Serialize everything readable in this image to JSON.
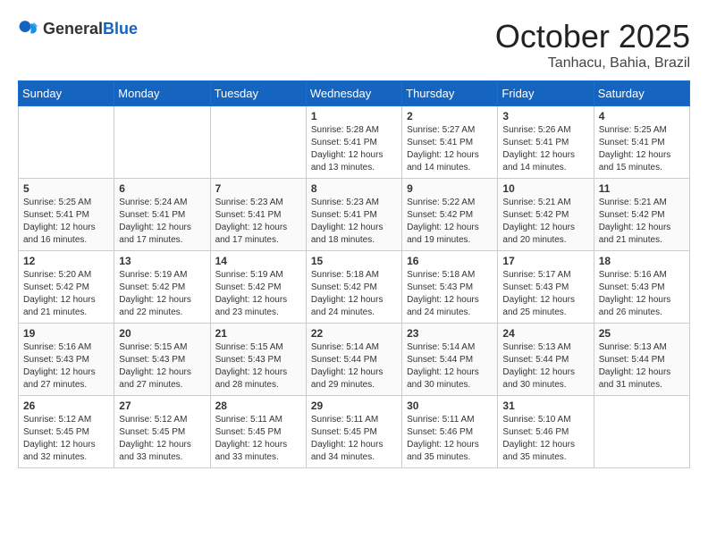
{
  "header": {
    "logo_general": "General",
    "logo_blue": "Blue",
    "month": "October 2025",
    "location": "Tanhacu, Bahia, Brazil"
  },
  "days_of_week": [
    "Sunday",
    "Monday",
    "Tuesday",
    "Wednesday",
    "Thursday",
    "Friday",
    "Saturday"
  ],
  "weeks": [
    [
      {
        "day": "",
        "info": ""
      },
      {
        "day": "",
        "info": ""
      },
      {
        "day": "",
        "info": ""
      },
      {
        "day": "1",
        "info": "Sunrise: 5:28 AM\nSunset: 5:41 PM\nDaylight: 12 hours\nand 13 minutes."
      },
      {
        "day": "2",
        "info": "Sunrise: 5:27 AM\nSunset: 5:41 PM\nDaylight: 12 hours\nand 14 minutes."
      },
      {
        "day": "3",
        "info": "Sunrise: 5:26 AM\nSunset: 5:41 PM\nDaylight: 12 hours\nand 14 minutes."
      },
      {
        "day": "4",
        "info": "Sunrise: 5:25 AM\nSunset: 5:41 PM\nDaylight: 12 hours\nand 15 minutes."
      }
    ],
    [
      {
        "day": "5",
        "info": "Sunrise: 5:25 AM\nSunset: 5:41 PM\nDaylight: 12 hours\nand 16 minutes."
      },
      {
        "day": "6",
        "info": "Sunrise: 5:24 AM\nSunset: 5:41 PM\nDaylight: 12 hours\nand 17 minutes."
      },
      {
        "day": "7",
        "info": "Sunrise: 5:23 AM\nSunset: 5:41 PM\nDaylight: 12 hours\nand 17 minutes."
      },
      {
        "day": "8",
        "info": "Sunrise: 5:23 AM\nSunset: 5:41 PM\nDaylight: 12 hours\nand 18 minutes."
      },
      {
        "day": "9",
        "info": "Sunrise: 5:22 AM\nSunset: 5:42 PM\nDaylight: 12 hours\nand 19 minutes."
      },
      {
        "day": "10",
        "info": "Sunrise: 5:21 AM\nSunset: 5:42 PM\nDaylight: 12 hours\nand 20 minutes."
      },
      {
        "day": "11",
        "info": "Sunrise: 5:21 AM\nSunset: 5:42 PM\nDaylight: 12 hours\nand 21 minutes."
      }
    ],
    [
      {
        "day": "12",
        "info": "Sunrise: 5:20 AM\nSunset: 5:42 PM\nDaylight: 12 hours\nand 21 minutes."
      },
      {
        "day": "13",
        "info": "Sunrise: 5:19 AM\nSunset: 5:42 PM\nDaylight: 12 hours\nand 22 minutes."
      },
      {
        "day": "14",
        "info": "Sunrise: 5:19 AM\nSunset: 5:42 PM\nDaylight: 12 hours\nand 23 minutes."
      },
      {
        "day": "15",
        "info": "Sunrise: 5:18 AM\nSunset: 5:42 PM\nDaylight: 12 hours\nand 24 minutes."
      },
      {
        "day": "16",
        "info": "Sunrise: 5:18 AM\nSunset: 5:43 PM\nDaylight: 12 hours\nand 24 minutes."
      },
      {
        "day": "17",
        "info": "Sunrise: 5:17 AM\nSunset: 5:43 PM\nDaylight: 12 hours\nand 25 minutes."
      },
      {
        "day": "18",
        "info": "Sunrise: 5:16 AM\nSunset: 5:43 PM\nDaylight: 12 hours\nand 26 minutes."
      }
    ],
    [
      {
        "day": "19",
        "info": "Sunrise: 5:16 AM\nSunset: 5:43 PM\nDaylight: 12 hours\nand 27 minutes."
      },
      {
        "day": "20",
        "info": "Sunrise: 5:15 AM\nSunset: 5:43 PM\nDaylight: 12 hours\nand 27 minutes."
      },
      {
        "day": "21",
        "info": "Sunrise: 5:15 AM\nSunset: 5:43 PM\nDaylight: 12 hours\nand 28 minutes."
      },
      {
        "day": "22",
        "info": "Sunrise: 5:14 AM\nSunset: 5:44 PM\nDaylight: 12 hours\nand 29 minutes."
      },
      {
        "day": "23",
        "info": "Sunrise: 5:14 AM\nSunset: 5:44 PM\nDaylight: 12 hours\nand 30 minutes."
      },
      {
        "day": "24",
        "info": "Sunrise: 5:13 AM\nSunset: 5:44 PM\nDaylight: 12 hours\nand 30 minutes."
      },
      {
        "day": "25",
        "info": "Sunrise: 5:13 AM\nSunset: 5:44 PM\nDaylight: 12 hours\nand 31 minutes."
      }
    ],
    [
      {
        "day": "26",
        "info": "Sunrise: 5:12 AM\nSunset: 5:45 PM\nDaylight: 12 hours\nand 32 minutes."
      },
      {
        "day": "27",
        "info": "Sunrise: 5:12 AM\nSunset: 5:45 PM\nDaylight: 12 hours\nand 33 minutes."
      },
      {
        "day": "28",
        "info": "Sunrise: 5:11 AM\nSunset: 5:45 PM\nDaylight: 12 hours\nand 33 minutes."
      },
      {
        "day": "29",
        "info": "Sunrise: 5:11 AM\nSunset: 5:45 PM\nDaylight: 12 hours\nand 34 minutes."
      },
      {
        "day": "30",
        "info": "Sunrise: 5:11 AM\nSunset: 5:46 PM\nDaylight: 12 hours\nand 35 minutes."
      },
      {
        "day": "31",
        "info": "Sunrise: 5:10 AM\nSunset: 5:46 PM\nDaylight: 12 hours\nand 35 minutes."
      },
      {
        "day": "",
        "info": ""
      }
    ]
  ]
}
